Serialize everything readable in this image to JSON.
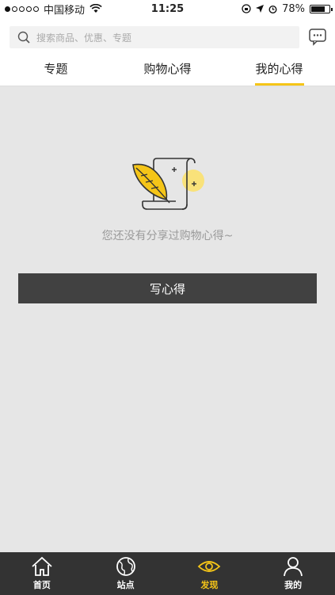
{
  "status_bar": {
    "carrier": "中国移动",
    "time": "11:25",
    "battery": "78%",
    "battery_level": 0.78
  },
  "search": {
    "placeholder": "搜索商品、优惠、专题",
    "icon": "search-icon",
    "message_icon": "message-icon"
  },
  "tabs": [
    {
      "label": "专题",
      "active": false
    },
    {
      "label": "购物心得",
      "active": false
    },
    {
      "label": "我的心得",
      "active": true
    }
  ],
  "empty_state": {
    "illustration": "quill-scroll-icon",
    "message": "您还没有分享过购物心得~",
    "button_label": "写心得"
  },
  "bottom_nav": [
    {
      "label": "首页",
      "icon": "home-icon",
      "active": false
    },
    {
      "label": "站点",
      "icon": "globe-icon",
      "active": false
    },
    {
      "label": "发现",
      "icon": "eye-icon",
      "active": true
    },
    {
      "label": "我的",
      "icon": "person-icon",
      "active": false
    }
  ],
  "colors": {
    "accent": "#f5c518",
    "background": "#e6e6e6",
    "button": "#414141",
    "nav_background": "#333333"
  }
}
